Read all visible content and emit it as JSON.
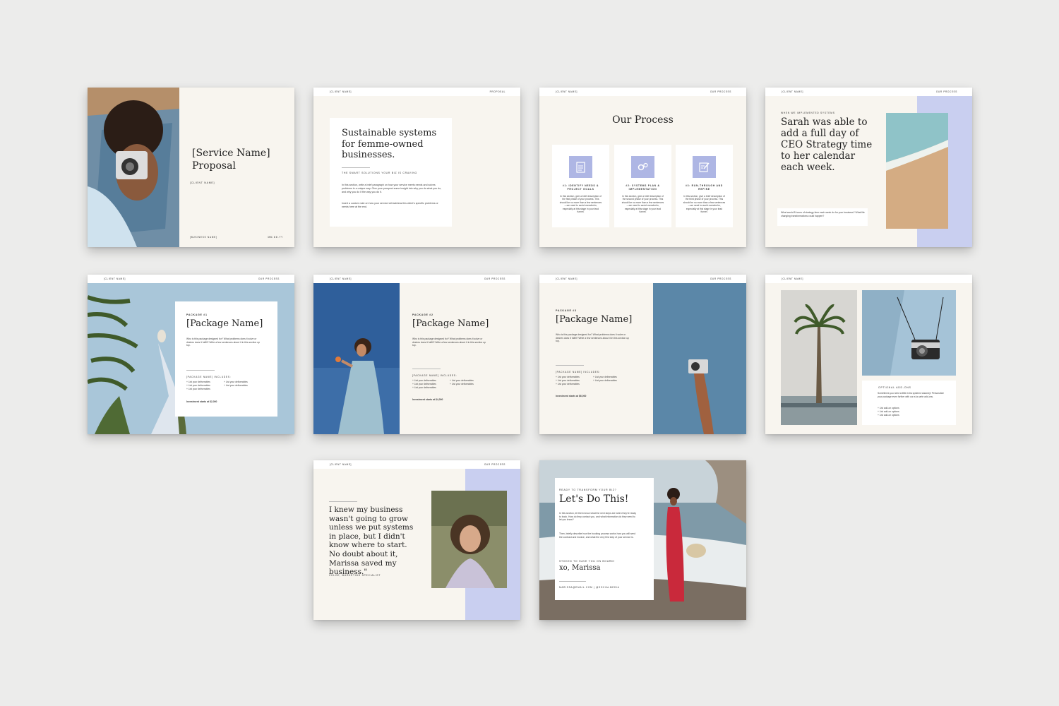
{
  "slides": {
    "s1": {
      "title_line1": "[Service Name]",
      "title_line2": "Proposal",
      "client": "[CLIENT NAME]",
      "business": "[BUSINESS NAME]",
      "date": "MM.DD.YY"
    },
    "s2": {
      "client": "[CLIENT NAME]",
      "section": "PROPOSAL",
      "heading": "Sustainable systems for femme-owned businesses.",
      "subheading": "THE SMART SOLUTIONS YOUR BIZ IS CRAVING",
      "para1": "In this section, write a brief paragraph on how your service meets needs and solves problems in a unique way. Give your prospect some insight into why you do what you do, and why you do it the way you do it.",
      "para2": "Insert a custom note on how your service will address this client's specific problems or needs here at the end."
    },
    "s3": {
      "client": "[CLIENT NAME]",
      "section": "OUR PROCESS",
      "heading": "Our Process",
      "steps": [
        {
          "title": "#1: IDENTIFY NEEDS & PROJECT GOALS",
          "body": "In this section, give a brief description of the first phase of your process. This should be no more than a few sentences—we need to avoid overwhelm, especially at this stage in your lead funnel."
        },
        {
          "title": "#2: SYSTEMS PLAN & IMPLEMENTATION",
          "body": "In this section, give a brief description of the second phase of your process. This should be no more than a few sentences—we need to avoid overwhelm, especially at this stage in your lead funnel."
        },
        {
          "title": "#3: RUN-THROUGH AND REFINE",
          "body": "In this section, give a brief description of the third phase of your process. This should be no more than a few sentences—we need to avoid overwhelm, especially at this stage in your lead funnel."
        }
      ]
    },
    "s4": {
      "client": "[CLIENT NAME]",
      "section": "OUR PROCESS",
      "eyebrow": "WHEN WE IMPLEMENTED SYSTEMS",
      "quote": "Sarah was able to add a full day of CEO Strategy time to her calendar each week.",
      "note": "What would 8 hours of strategy time each week do for your business? What life changing transformations could happen?"
    },
    "s5": {
      "client": "[CLIENT NAME]",
      "section": "OUR PROCESS",
      "label": "PACKAGE #1",
      "name": "[Package Name]",
      "desc": "Who is this package designed for? What problems does it solve or desires does it fulfill? Write a few sentences about it in this section up top.",
      "includes": "[PACKAGE NAME] INCLUDES:",
      "items_left": [
        "+ List your deliverables",
        "+ List your deliverables",
        "+ List your deliverables"
      ],
      "items_right": [
        "+ List your deliverables",
        "+ List your deliverables"
      ],
      "price": "Investment starts at $2,000"
    },
    "s6": {
      "client": "[CLIENT NAME]",
      "section": "OUR PROCESS",
      "label": "PACKAGE #2",
      "name": "[Package Name]",
      "desc": "Who is this package designed for? What problems does it solve or desires does it fulfill? Write a few sentences about it in this section up top.",
      "includes": "[PACKAGE NAME] INCLUDES:",
      "items_left": [
        "+ List your deliverables",
        "+ List your deliverables",
        "+ List your deliverables"
      ],
      "items_right": [
        "+ List your deliverables",
        "+ List your deliverables"
      ],
      "price": "Investment starts at $4,000"
    },
    "s7": {
      "client": "[CLIENT NAME]",
      "section": "OUR PROCESS",
      "label": "PACKAGE #3",
      "name": "[Package Name]",
      "desc": "Who is this package designed for? What problems does it solve or desires does it fulfill? Write a few sentences about it in this section up top.",
      "includes": "[PACKAGE NAME] INCLUDES:",
      "items_left": [
        "+ List your deliverables",
        "+ List your deliverables",
        "+ List your deliverables"
      ],
      "items_right": [
        "+ List your deliverables",
        "+ List your deliverables"
      ],
      "price": "Investment starts at $6,000"
    },
    "s8": {
      "client": "[CLIENT NAME]",
      "label": "OPTIONAL ADD-ONS",
      "desc": "Sometimes you need a little extra systems wizardry! Personalize your package even further with our a la carte add-ons.",
      "items": [
        "+ List add-on options",
        "+ List add-on options",
        "+ List add-on options"
      ]
    },
    "s9": {
      "client": "[CLIENT NAME]",
      "section": "OUR PROCESS",
      "quote": "I knew my business wasn't going to grow unless we put systems in place, but I didn't know where to start. No doubt about it, Marissa saved my business.\"",
      "author": "CHLOE, MARKETING SPECIALIST"
    },
    "s10": {
      "eyebrow": "READY TO TRANSFORM YOUR BIZ?",
      "heading": "Let's Do This!",
      "para1": "In this section, let them know what the next steps are when they're ready to book. How do they contact you, and what information do they need to let you know?",
      "para2": "Then, briefly describe how the booking process works how you will send the contract and invoice, and what the very first step of your service is.",
      "signoff_label": "STOKED TO HAVE YOU ON BOARD!",
      "signoff": "xo, Marissa",
      "contact": "MARISSA@EMAIL.COM | @SOCIALMEDIA"
    }
  },
  "colors": {
    "cream": "#f8f5ef",
    "lavender": "#c9cff0",
    "icon_blue": "#aeb6e4",
    "sky": "#a9c6d9",
    "steel_blue": "#5b87a8",
    "deep_blue": "#2f5f9b"
  }
}
